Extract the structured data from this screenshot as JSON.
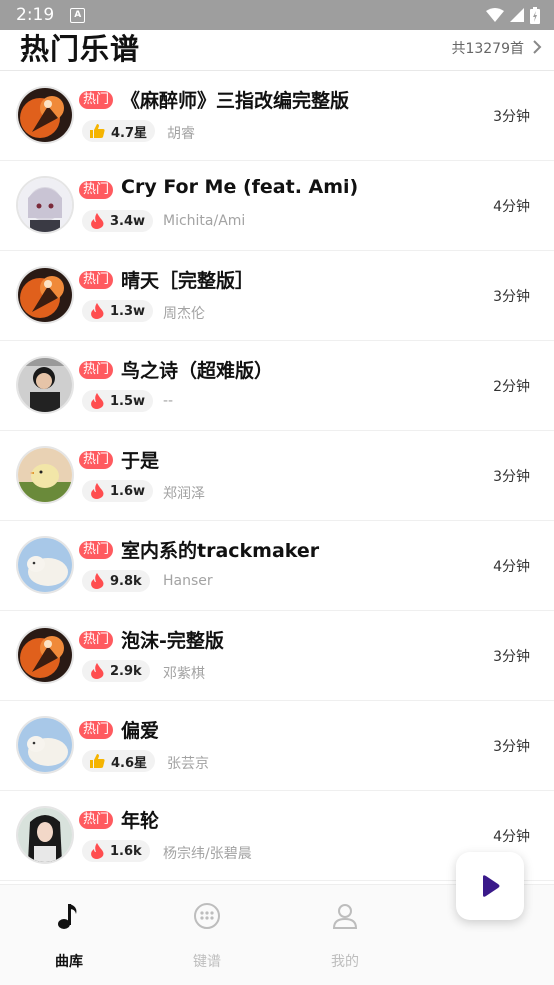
{
  "status_bar": {
    "time": "2:19",
    "notification_letter": "A"
  },
  "header": {
    "title": "热门乐谱",
    "count_text": "共13279首"
  },
  "songs": [
    {
      "tag": "热门",
      "title": "《麻醉师》三指改编完整版",
      "metric_icon": "thumb-up-icon",
      "metric": "4.7星",
      "artist": "胡睿",
      "duration": "3分钟",
      "avatar": "anime-orange"
    },
    {
      "tag": "热门",
      "title": "Cry For Me (feat. Ami)",
      "metric_icon": "fire-icon",
      "metric": "3.4w",
      "artist": "Michita/Ami",
      "duration": "4分钟",
      "avatar": "anime-white"
    },
    {
      "tag": "热门",
      "title": "晴天［完整版］",
      "metric_icon": "fire-icon",
      "metric": "1.3w",
      "artist": "周杰伦",
      "duration": "3分钟",
      "avatar": "anime-orange"
    },
    {
      "tag": "热门",
      "title": "鸟之诗（超难版）",
      "metric_icon": "fire-icon",
      "metric": "1.5w",
      "artist": "--",
      "duration": "2分钟",
      "avatar": "photo-boy"
    },
    {
      "tag": "热门",
      "title": "于是",
      "metric_icon": "fire-icon",
      "metric": "1.6w",
      "artist": "郑润泽",
      "duration": "3分钟",
      "avatar": "photo-chick"
    },
    {
      "tag": "热门",
      "title": "室内系的trackmaker",
      "metric_icon": "fire-icon",
      "metric": "9.8k",
      "artist": "Hanser",
      "duration": "4分钟",
      "avatar": "photo-lamb"
    },
    {
      "tag": "热门",
      "title": "泡沫-完整版",
      "metric_icon": "fire-icon",
      "metric": "2.9k",
      "artist": "邓紫棋",
      "duration": "3分钟",
      "avatar": "anime-orange"
    },
    {
      "tag": "热门",
      "title": "偏爱",
      "metric_icon": "thumb-up-icon",
      "metric": "4.6星",
      "artist": "张芸京",
      "duration": "3分钟",
      "avatar": "photo-lamb"
    },
    {
      "tag": "热门",
      "title": "年轮",
      "metric_icon": "fire-icon",
      "metric": "1.6k",
      "artist": "杨宗纬/张碧晨",
      "duration": "4分钟",
      "avatar": "photo-girl"
    }
  ],
  "bottom_nav": [
    {
      "label": "曲库",
      "icon": "music-note-icon",
      "active": true
    },
    {
      "label": "键谱",
      "icon": "keypad-icon",
      "active": false
    },
    {
      "label": "我的",
      "icon": "user-icon",
      "active": false
    }
  ],
  "colors": {
    "hot_tag": "#ff5a5f",
    "fire": "#ff4d4f",
    "thumb": "#f5b400",
    "fab_icon": "#3a1a8a",
    "inactive_nav": "#bdbdbd"
  }
}
